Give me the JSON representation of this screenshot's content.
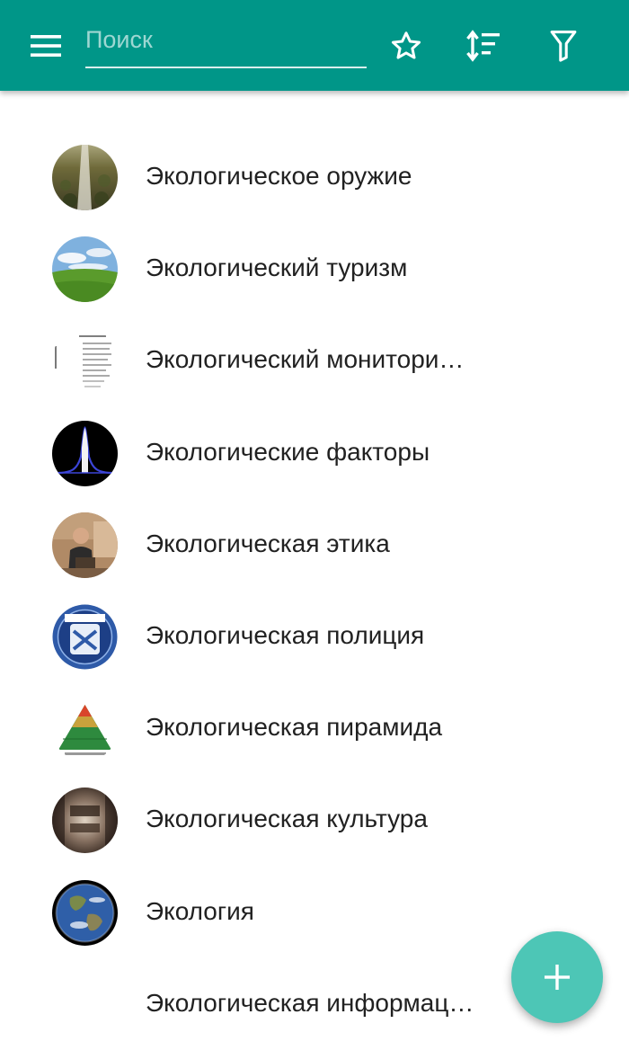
{
  "colors": {
    "appbar": "#009688",
    "fab": "#4dc6b6",
    "text": "#212121"
  },
  "toolbar": {
    "menu_icon": "hamburger-menu-icon",
    "search_placeholder": "Поиск",
    "search_value": "",
    "favorites_icon": "star-outline-icon",
    "sort_icon": "sort-icon",
    "filter_icon": "filter-icon"
  },
  "items": [
    {
      "title": "Экологическое оружие",
      "thumbnail": "aerial-landscape"
    },
    {
      "title": "Экологический туризм",
      "thumbnail": "green-meadow-sky"
    },
    {
      "title": "Экологический монитори…",
      "thumbnail": "text-document"
    },
    {
      "title": "Экологические факторы",
      "thumbnail": "bell-curve"
    },
    {
      "title": "Экологическая этика",
      "thumbnail": "lecturer-photo"
    },
    {
      "title": "Экологическая полиция",
      "thumbnail": "police-emblem"
    },
    {
      "title": "Экологическая пирамида",
      "thumbnail": "pyramid-diagram"
    },
    {
      "title": "Экологическая культура",
      "thumbnail": "blurry-photo"
    },
    {
      "title": "Экология",
      "thumbnail": "earth-globe"
    },
    {
      "title": "Экологическая информац…",
      "thumbnail": ""
    }
  ],
  "fab": {
    "icon": "plus-icon"
  }
}
